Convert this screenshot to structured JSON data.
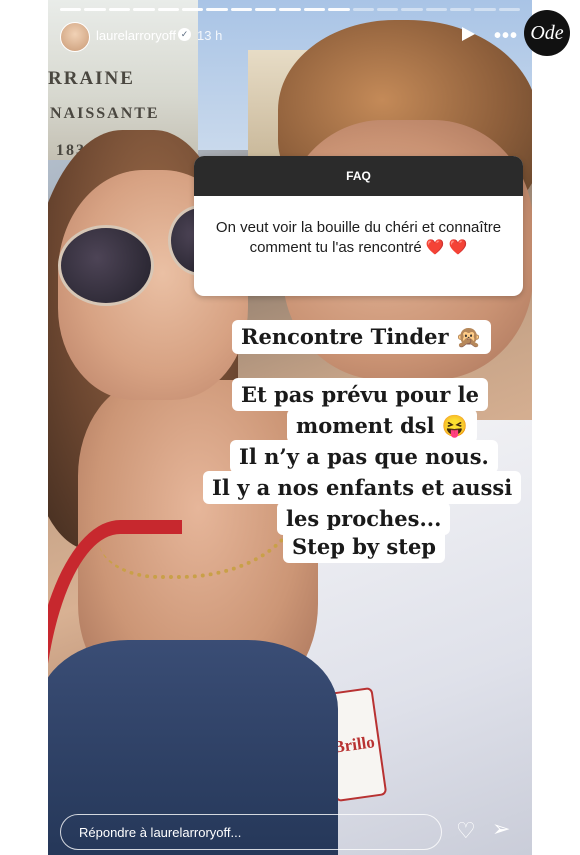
{
  "header": {
    "username": "laurelarroryoff",
    "time": "13 h",
    "progress_segments_viewed": 12,
    "progress_segments_total": 19
  },
  "background_text": {
    "line1": "RRAINE",
    "line2": "NAISSANTE",
    "line3": "183"
  },
  "question_card": {
    "header": "FAQ",
    "question": "On veut voir la bouille du chéri et connaître comment tu l'as rencontré ❤️ ❤️"
  },
  "stickers": {
    "s1": "Rencontre Tinder 🙊",
    "s2": "Et pas prévu pour le",
    "s3": "moment dsl 😝",
    "s4": "Il n’y a pas que nous.",
    "s5": "Il y a nos enfants et aussi",
    "s6": "les proches...",
    "s7": "Step by step"
  },
  "shirt_logo": "Brillo",
  "footer": {
    "reply_placeholder": "Répondre à laurelarroryoff..."
  },
  "watermark": "Ode",
  "icons": {
    "verified": "verified-badge-icon",
    "play": "play-icon",
    "more": "more-icon",
    "like": "heart-icon",
    "send": "send-icon"
  },
  "colors": {
    "faq_header": "#2b2b2b",
    "sticker_bg": "#ffffff",
    "bag_strap": "#c7282e"
  }
}
